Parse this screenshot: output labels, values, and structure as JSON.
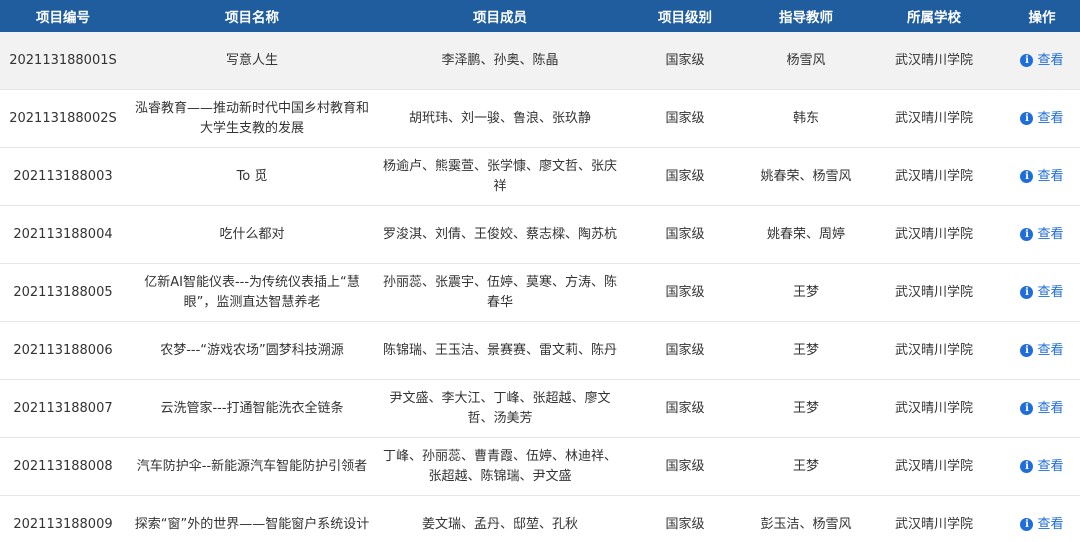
{
  "table": {
    "headers": {
      "code": "项目编号",
      "name": "项目名称",
      "members": "项目成员",
      "level": "项目级别",
      "advisor": "指导教师",
      "school": "所属学校",
      "action": "操作"
    },
    "action_label": "查看",
    "rows": [
      {
        "code": "202113188001S",
        "name": "写意人生",
        "members": "李泽鹏、孙奥、陈晶",
        "level": "国家级",
        "advisor": "杨雪风",
        "school": "武汉晴川学院"
      },
      {
        "code": "202113188002S",
        "name": "泓睿教育——推动新时代中国乡村教育和大学生支教的发展",
        "members": "胡玳玮、刘一骏、鲁浪、张玖静",
        "level": "国家级",
        "advisor": "韩东",
        "school": "武汉晴川学院"
      },
      {
        "code": "202113188003",
        "name": "To 觅",
        "members": "杨逾卢、熊霙萱、张学慷、廖文哲、张庆祥",
        "level": "国家级",
        "advisor": "姚春荣、杨雪风",
        "school": "武汉晴川学院"
      },
      {
        "code": "202113188004",
        "name": "吃什么都对",
        "members": "罗浚淇、刘倩、王俊姣、蔡志樑、陶苏杭",
        "level": "国家级",
        "advisor": "姚春荣、周婷",
        "school": "武汉晴川学院"
      },
      {
        "code": "202113188005",
        "name": "亿新AI智能仪表---为传统仪表插上“慧眼”，监测直达智慧养老",
        "members": "孙丽蕊、张震宇、伍婷、莫寒、方涛、陈春华",
        "level": "国家级",
        "advisor": "王梦",
        "school": "武汉晴川学院"
      },
      {
        "code": "202113188006",
        "name": "农梦---“游戏农场”圆梦科技溯源",
        "members": "陈锦瑞、王玉洁、景赛赛、雷文莉、陈丹",
        "level": "国家级",
        "advisor": "王梦",
        "school": "武汉晴川学院"
      },
      {
        "code": "202113188007",
        "name": "云洗管家---打通智能洗衣全链条",
        "members": "尹文盛、李大江、丁峰、张超越、廖文哲、汤美芳",
        "level": "国家级",
        "advisor": "王梦",
        "school": "武汉晴川学院"
      },
      {
        "code": "202113188008",
        "name": "汽车防护伞--新能源汽车智能防护引领者",
        "members": "丁峰、孙丽蕊、曹青霞、伍婷、林迪祥、张超越、陈锦瑞、尹文盛",
        "level": "国家级",
        "advisor": "王梦",
        "school": "武汉晴川学院"
      },
      {
        "code": "202113188009",
        "name": "探索“窗”外的世界——智能窗户系统设计",
        "members": "姜文瑞、孟丹、邸堃、孔秋",
        "level": "国家级",
        "advisor": "彭玉洁、杨雪风",
        "school": "武汉晴川学院"
      }
    ]
  }
}
